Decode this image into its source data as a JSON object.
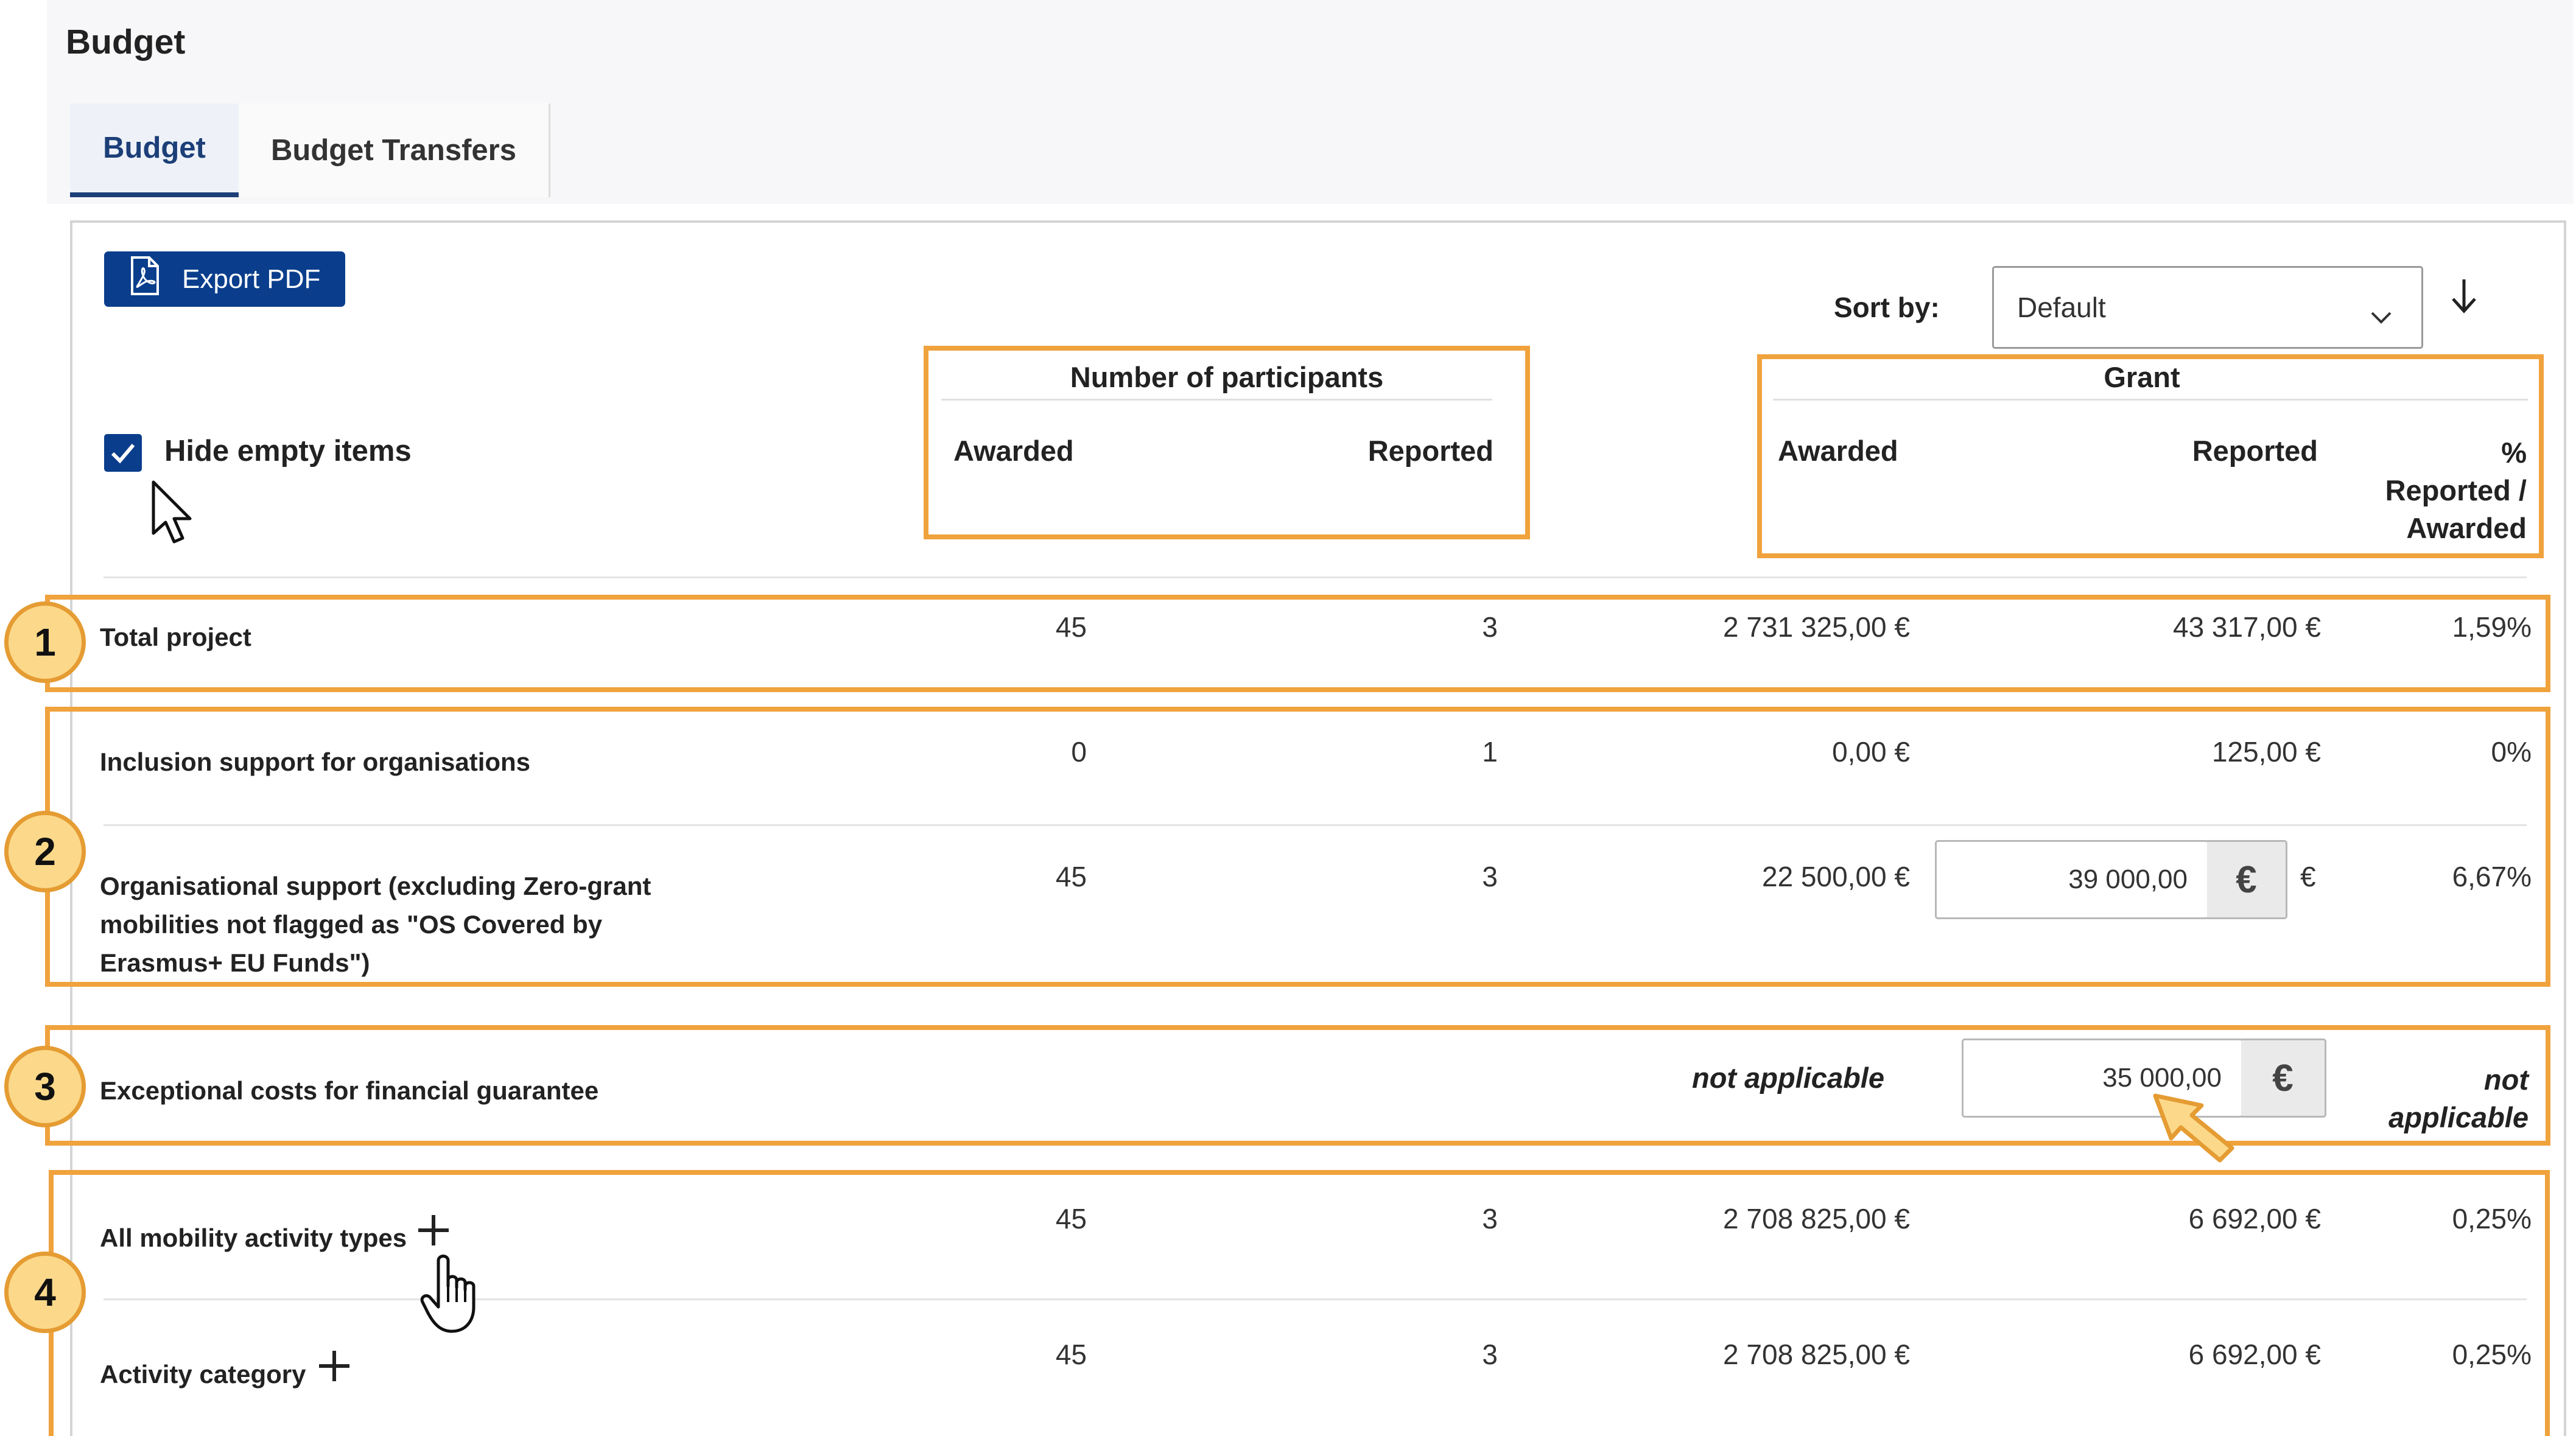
{
  "page": {
    "title": "Budget"
  },
  "tabs": [
    {
      "label": "Budget",
      "active": true
    },
    {
      "label": "Budget Transfers",
      "active": false
    }
  ],
  "toolbar": {
    "export_label": "Export PDF",
    "sort_label": "Sort by:",
    "sort_value": "Default"
  },
  "filter": {
    "hide_empty_label": "Hide empty items",
    "hide_empty_checked": true
  },
  "headers": {
    "participants": {
      "title": "Number of participants",
      "awarded": "Awarded",
      "reported": "Reported"
    },
    "grant": {
      "title": "Grant",
      "awarded": "Awarded",
      "reported": "Reported",
      "percent_line1": "%",
      "percent_line2": "Reported /",
      "percent_line3": "Awarded"
    }
  },
  "rows": [
    {
      "label": "Total project",
      "p_awarded": "45",
      "p_reported": "3",
      "g_awarded": "2 731 325,00 €",
      "g_reported": "43 317,00 €",
      "percent": "1,59%"
    },
    {
      "label": "Inclusion support for organisations",
      "p_awarded": "0",
      "p_reported": "1",
      "g_awarded": "0,00 €",
      "g_reported": "125,00 €",
      "percent": "0%"
    },
    {
      "label_line1": "Organisational support (excluding Zero-grant",
      "label_line2": "mobilities not flagged as \"OS Covered by",
      "label_line3": "Erasmus+ EU Funds\")",
      "p_awarded": "45",
      "p_reported": "3",
      "g_awarded": "22 500,00 €",
      "g_reported_input": "39 000,00",
      "currency_addon": "€",
      "currency_suffix": "€",
      "percent": "6,67%"
    },
    {
      "label": "Exceptional costs for financial guarantee",
      "g_awarded_text": "not applicable",
      "g_reported_input": "35 000,00",
      "currency_addon": "€",
      "percent_line1": "not",
      "percent_line2": "applicable"
    },
    {
      "label": "All mobility activity types",
      "p_awarded": "45",
      "p_reported": "3",
      "g_awarded": "2 708 825,00 €",
      "g_reported": "6 692,00 €",
      "percent": "0,25%"
    },
    {
      "label": "Activity category",
      "p_awarded": "45",
      "p_reported": "3",
      "g_awarded": "2 708 825,00 €",
      "g_reported": "6 692,00 €",
      "percent": "0,25%"
    }
  ],
  "badges": [
    "1",
    "2",
    "3",
    "4"
  ],
  "colors": {
    "primary": "#0a3e8c",
    "highlight": "#f0a23c",
    "badge_fill": "#fcd98a"
  },
  "icons": [
    "pdf-icon",
    "chevron-down-icon",
    "arrow-down-icon",
    "checkmark-icon",
    "plus-icon",
    "arrow-cursor-icon",
    "hand-cursor-icon",
    "callout-arrow-icon"
  ]
}
